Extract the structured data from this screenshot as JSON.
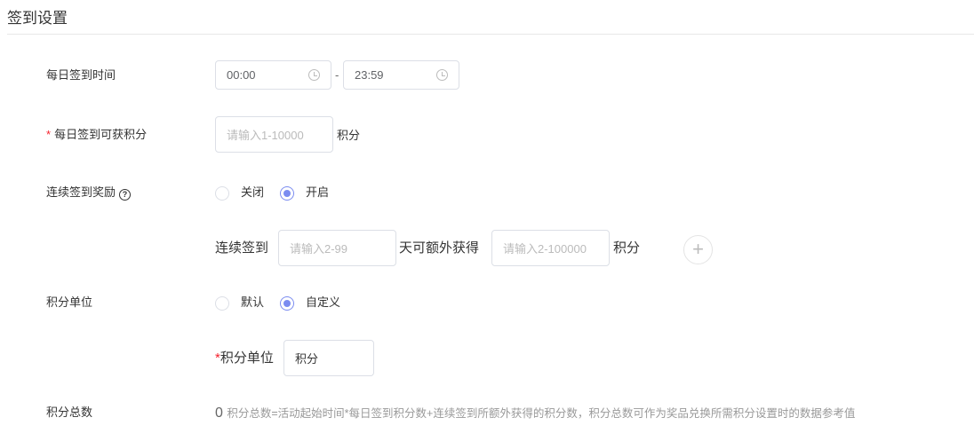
{
  "title": "签到设置",
  "daily_time": {
    "label": "每日签到时间",
    "start": "00:00",
    "separator": "-",
    "end": "23:59"
  },
  "daily_points": {
    "required": "*",
    "label": "每日签到可获积分",
    "placeholder": "请输入1-10000",
    "unit": "积分"
  },
  "streak": {
    "label": "连续签到奖励",
    "help": "?",
    "options": [
      {
        "label": "关闭",
        "selected": false
      },
      {
        "label": "开启",
        "selected": true
      }
    ],
    "prefix": "连续签到",
    "days_placeholder": "请输入2-99",
    "middle": "天可额外获得",
    "points_placeholder": "请输入2-100000",
    "unit": "积分",
    "add": "+"
  },
  "unit": {
    "label": "积分单位",
    "options": [
      {
        "label": "默认",
        "selected": false
      },
      {
        "label": "自定义",
        "selected": true
      }
    ],
    "custom_required": "*",
    "custom_label": "积分单位",
    "custom_value": "积分"
  },
  "total": {
    "label": "积分总数",
    "value": "0",
    "note": "积分总数=活动起始时间*每日签到积分数+连续签到所额外获得的积分数，积分总数可作为奖品兑换所需积分设置时的数据参考值"
  },
  "colors": {
    "accent": "#7b8cf0",
    "required": "#f5222d"
  }
}
